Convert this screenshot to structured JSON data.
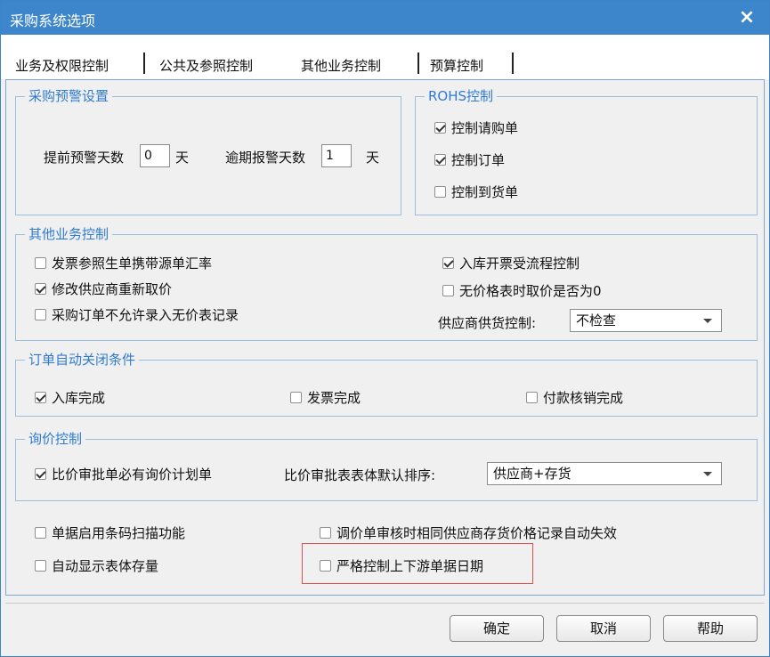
{
  "window": {
    "title": "采购系统选项",
    "close": "×"
  },
  "tabs": [
    {
      "label": "业务及权限控制"
    },
    {
      "label": "公共及参照控制"
    },
    {
      "label": "其他业务控制"
    },
    {
      "label": "预算控制"
    }
  ],
  "warning": {
    "legend": "采购预警设置",
    "advance_label": "提前预警天数",
    "advance_value": "0",
    "advance_unit": "天",
    "overdue_label": "逾期报警天数",
    "overdue_value": "1",
    "overdue_unit": "天"
  },
  "rohs": {
    "legend": "ROHS控制",
    "items": [
      {
        "label": "控制请购单",
        "checked": true
      },
      {
        "label": "控制订单",
        "checked": true
      },
      {
        "label": "控制到货单",
        "checked": false
      }
    ]
  },
  "other": {
    "legend": "其他业务控制",
    "items": [
      {
        "label": "发票参照生单携带源单汇率",
        "checked": false
      },
      {
        "label": "修改供应商重新取价",
        "checked": true
      },
      {
        "label": "采购订单不允许录入无价表记录",
        "checked": false
      },
      {
        "label": "入库开票受流程控制",
        "checked": true
      },
      {
        "label": "无价格表时取价是否为0",
        "checked": false
      }
    ],
    "supplier_label": "供应商供货控制:",
    "supplier_value": "不检查"
  },
  "autoclose": {
    "legend": "订单自动关闭条件",
    "items": [
      {
        "label": "入库完成",
        "checked": true
      },
      {
        "label": "发票完成",
        "checked": false
      },
      {
        "label": "付款核销完成",
        "checked": false
      }
    ]
  },
  "inquiry": {
    "legend": "询价控制",
    "item": {
      "label": "比价审批单必有询价计划单",
      "checked": true
    },
    "sort_label": "比价审批表表体默认排序:",
    "sort_value": "供应商+存货"
  },
  "misc": {
    "items": [
      {
        "label": "单据启用条码扫描功能",
        "checked": false
      },
      {
        "label": "自动显示表体存量",
        "checked": false
      },
      {
        "label": "调价单审核时相同供应商存货价格记录自动失效",
        "checked": false
      },
      {
        "label": "严格控制上下游单据日期",
        "checked": false
      }
    ]
  },
  "buttons": {
    "ok": "确定",
    "cancel": "取消",
    "help": "帮助"
  },
  "colors": {
    "titlebar": "#3e86cc",
    "legend": "#2f7bd1",
    "highlight": "#e0504f"
  }
}
